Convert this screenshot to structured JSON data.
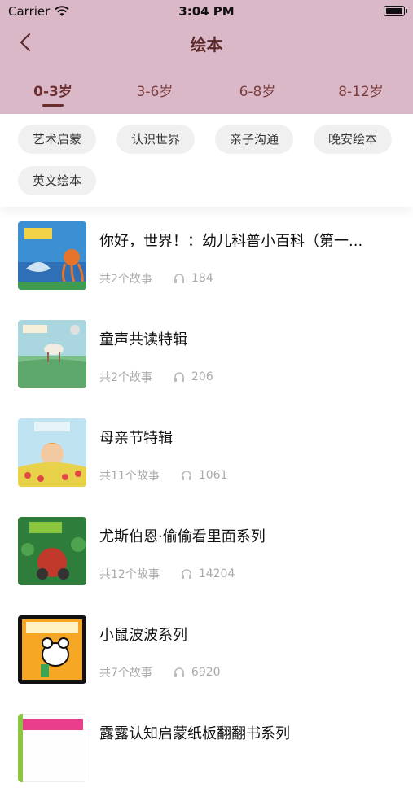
{
  "status_bar": {
    "carrier": "Carrier",
    "time": "3:04 PM"
  },
  "nav": {
    "title": "绘本"
  },
  "tabs": [
    {
      "label": "0-3岁",
      "active": true
    },
    {
      "label": "3-6岁",
      "active": false
    },
    {
      "label": "6-8岁",
      "active": false
    },
    {
      "label": "8-12岁",
      "active": false
    }
  ],
  "filters": [
    "艺术启蒙",
    "认识世界",
    "亲子沟通",
    "晚安绘本",
    "英文绘本"
  ],
  "items": [
    {
      "title": "你好，世界！：幼儿科普小百科（第一...",
      "count": "共2个故事",
      "plays": "184"
    },
    {
      "title": "童声共读特辑",
      "count": "共2个故事",
      "plays": "206"
    },
    {
      "title": "母亲节特辑",
      "count": "共11个故事",
      "plays": "1061"
    },
    {
      "title": "尤斯伯恩·偷偷看里面系列",
      "count": "共12个故事",
      "plays": "14204"
    },
    {
      "title": "小鼠波波系列",
      "count": "共7个故事",
      "plays": "6920"
    },
    {
      "title": "露露认知启蒙纸板翻翻书系列",
      "count": "",
      "plays": ""
    }
  ],
  "colors": {
    "header_bg": "#dbb8c7",
    "accent": "#6b2e2e",
    "chip_bg": "#f0f0f0",
    "meta_text": "#aaaaaa"
  },
  "icons": [
    "wifi-icon",
    "battery-icon",
    "back-chevron-icon",
    "headphone-icon"
  ]
}
